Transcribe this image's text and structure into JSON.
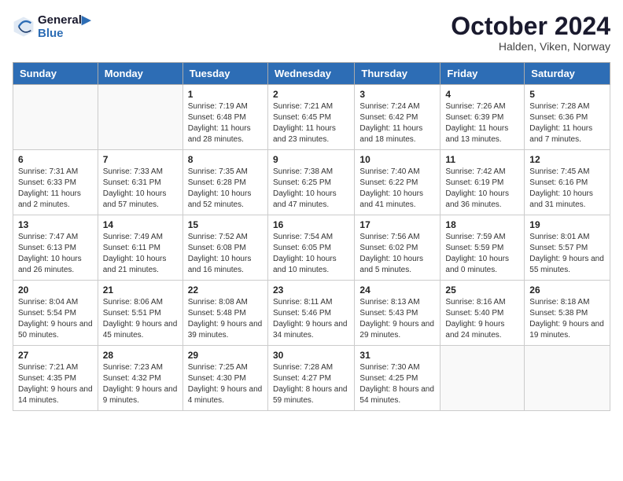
{
  "header": {
    "logo_line1": "General",
    "logo_line2": "Blue",
    "month": "October 2024",
    "location": "Halden, Viken, Norway"
  },
  "weekdays": [
    "Sunday",
    "Monday",
    "Tuesday",
    "Wednesday",
    "Thursday",
    "Friday",
    "Saturday"
  ],
  "weeks": [
    [
      {
        "day": "",
        "info": ""
      },
      {
        "day": "",
        "info": ""
      },
      {
        "day": "1",
        "info": "Sunrise: 7:19 AM\nSunset: 6:48 PM\nDaylight: 11 hours and 28 minutes."
      },
      {
        "day": "2",
        "info": "Sunrise: 7:21 AM\nSunset: 6:45 PM\nDaylight: 11 hours and 23 minutes."
      },
      {
        "day": "3",
        "info": "Sunrise: 7:24 AM\nSunset: 6:42 PM\nDaylight: 11 hours and 18 minutes."
      },
      {
        "day": "4",
        "info": "Sunrise: 7:26 AM\nSunset: 6:39 PM\nDaylight: 11 hours and 13 minutes."
      },
      {
        "day": "5",
        "info": "Sunrise: 7:28 AM\nSunset: 6:36 PM\nDaylight: 11 hours and 7 minutes."
      }
    ],
    [
      {
        "day": "6",
        "info": "Sunrise: 7:31 AM\nSunset: 6:33 PM\nDaylight: 11 hours and 2 minutes."
      },
      {
        "day": "7",
        "info": "Sunrise: 7:33 AM\nSunset: 6:31 PM\nDaylight: 10 hours and 57 minutes."
      },
      {
        "day": "8",
        "info": "Sunrise: 7:35 AM\nSunset: 6:28 PM\nDaylight: 10 hours and 52 minutes."
      },
      {
        "day": "9",
        "info": "Sunrise: 7:38 AM\nSunset: 6:25 PM\nDaylight: 10 hours and 47 minutes."
      },
      {
        "day": "10",
        "info": "Sunrise: 7:40 AM\nSunset: 6:22 PM\nDaylight: 10 hours and 41 minutes."
      },
      {
        "day": "11",
        "info": "Sunrise: 7:42 AM\nSunset: 6:19 PM\nDaylight: 10 hours and 36 minutes."
      },
      {
        "day": "12",
        "info": "Sunrise: 7:45 AM\nSunset: 6:16 PM\nDaylight: 10 hours and 31 minutes."
      }
    ],
    [
      {
        "day": "13",
        "info": "Sunrise: 7:47 AM\nSunset: 6:13 PM\nDaylight: 10 hours and 26 minutes."
      },
      {
        "day": "14",
        "info": "Sunrise: 7:49 AM\nSunset: 6:11 PM\nDaylight: 10 hours and 21 minutes."
      },
      {
        "day": "15",
        "info": "Sunrise: 7:52 AM\nSunset: 6:08 PM\nDaylight: 10 hours and 16 minutes."
      },
      {
        "day": "16",
        "info": "Sunrise: 7:54 AM\nSunset: 6:05 PM\nDaylight: 10 hours and 10 minutes."
      },
      {
        "day": "17",
        "info": "Sunrise: 7:56 AM\nSunset: 6:02 PM\nDaylight: 10 hours and 5 minutes."
      },
      {
        "day": "18",
        "info": "Sunrise: 7:59 AM\nSunset: 5:59 PM\nDaylight: 10 hours and 0 minutes."
      },
      {
        "day": "19",
        "info": "Sunrise: 8:01 AM\nSunset: 5:57 PM\nDaylight: 9 hours and 55 minutes."
      }
    ],
    [
      {
        "day": "20",
        "info": "Sunrise: 8:04 AM\nSunset: 5:54 PM\nDaylight: 9 hours and 50 minutes."
      },
      {
        "day": "21",
        "info": "Sunrise: 8:06 AM\nSunset: 5:51 PM\nDaylight: 9 hours and 45 minutes."
      },
      {
        "day": "22",
        "info": "Sunrise: 8:08 AM\nSunset: 5:48 PM\nDaylight: 9 hours and 39 minutes."
      },
      {
        "day": "23",
        "info": "Sunrise: 8:11 AM\nSunset: 5:46 PM\nDaylight: 9 hours and 34 minutes."
      },
      {
        "day": "24",
        "info": "Sunrise: 8:13 AM\nSunset: 5:43 PM\nDaylight: 9 hours and 29 minutes."
      },
      {
        "day": "25",
        "info": "Sunrise: 8:16 AM\nSunset: 5:40 PM\nDaylight: 9 hours and 24 minutes."
      },
      {
        "day": "26",
        "info": "Sunrise: 8:18 AM\nSunset: 5:38 PM\nDaylight: 9 hours and 19 minutes."
      }
    ],
    [
      {
        "day": "27",
        "info": "Sunrise: 7:21 AM\nSunset: 4:35 PM\nDaylight: 9 hours and 14 minutes."
      },
      {
        "day": "28",
        "info": "Sunrise: 7:23 AM\nSunset: 4:32 PM\nDaylight: 9 hours and 9 minutes."
      },
      {
        "day": "29",
        "info": "Sunrise: 7:25 AM\nSunset: 4:30 PM\nDaylight: 9 hours and 4 minutes."
      },
      {
        "day": "30",
        "info": "Sunrise: 7:28 AM\nSunset: 4:27 PM\nDaylight: 8 hours and 59 minutes."
      },
      {
        "day": "31",
        "info": "Sunrise: 7:30 AM\nSunset: 4:25 PM\nDaylight: 8 hours and 54 minutes."
      },
      {
        "day": "",
        "info": ""
      },
      {
        "day": "",
        "info": ""
      }
    ]
  ]
}
